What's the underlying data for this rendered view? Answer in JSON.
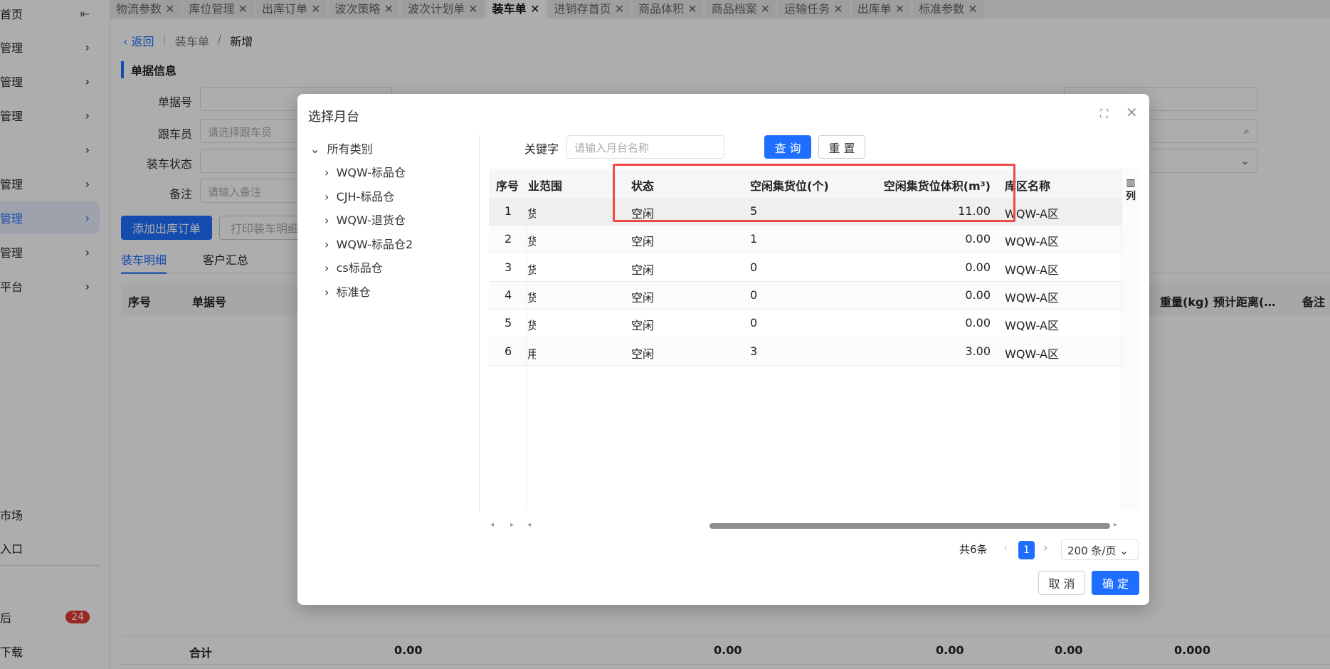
{
  "sidebar": {
    "collapse_icon": "collapse-left-icon",
    "items": [
      {
        "label": "首页"
      },
      {
        "label": "管理"
      },
      {
        "label": "管理"
      },
      {
        "label": "管理"
      },
      {
        "label": ""
      },
      {
        "label": "管理"
      },
      {
        "label": "管理",
        "active": true
      },
      {
        "label": "管理"
      },
      {
        "label": "平台"
      }
    ],
    "bottom_items": [
      {
        "label": "市场"
      },
      {
        "label": "入口"
      },
      {
        "label": "后",
        "badge": "24"
      },
      {
        "label": "下载"
      }
    ]
  },
  "tabs": [
    {
      "label": "物流参数"
    },
    {
      "label": "库位管理"
    },
    {
      "label": "出库订单"
    },
    {
      "label": "波次策略"
    },
    {
      "label": "波次计划单"
    },
    {
      "label": "装车单",
      "active": true
    },
    {
      "label": "进销存首页"
    },
    {
      "label": "商品体积"
    },
    {
      "label": "商品档案"
    },
    {
      "label": "运输任务"
    },
    {
      "label": "出库单"
    },
    {
      "label": "标准参数"
    }
  ],
  "breadcrumb": {
    "back": "返回",
    "parent": "装车单",
    "sep": "/",
    "current": "新增"
  },
  "section_title": "单据信息",
  "form": {
    "doc_no": "单据号",
    "follower": "跟车员",
    "follower_placeholder": "请选择跟车员",
    "status": "装车状态",
    "remark": "备注",
    "remark_placeholder": "请输入备注"
  },
  "actions": {
    "add_order": "添加出库订单",
    "print": "打印装车明细"
  },
  "detail_tabs": {
    "detail": "装车明细",
    "customer": "客户汇总"
  },
  "bg_table": {
    "headers": {
      "index": "序号",
      "doc_no": "单据号",
      "weight": "重量(kg)",
      "distance": "预计距离(…",
      "remark": "备注"
    },
    "totals": {
      "label": "合计",
      "v1": "0.00",
      "v2": "0.00",
      "v3": "0.00",
      "v4": "0.00",
      "v5": "0.00",
      "v6": "0"
    }
  },
  "modal": {
    "title": "选择月台",
    "tree": {
      "root": "所有类别",
      "children": [
        "WQW-标品仓",
        "CJH-标品仓",
        "WQW-退货仓",
        "WQW-标品仓2",
        "cs标品仓",
        "标准仓"
      ]
    },
    "keyword_label": "关键字",
    "keyword_placeholder": "请输入月台名称",
    "query": "查 询",
    "reset": "重 置",
    "columns": {
      "index": "序号",
      "scope": "业范围",
      "status": "状态",
      "free_slots": "空闲集货位(个)",
      "free_volume": "空闲集货位体积(m³)",
      "zone": "库区名称",
      "settings": "列"
    },
    "rows": [
      {
        "index": "1",
        "scope": "货",
        "status": "空闲",
        "free_slots": "5",
        "free_volume": "11.00",
        "zone": "WQW-A区"
      },
      {
        "index": "2",
        "scope": "货",
        "status": "空闲",
        "free_slots": "1",
        "free_volume": "0.00",
        "zone": "WQW-A区"
      },
      {
        "index": "3",
        "scope": "货",
        "status": "空闲",
        "free_slots": "0",
        "free_volume": "0.00",
        "zone": "WQW-A区"
      },
      {
        "index": "4",
        "scope": "货",
        "status": "空闲",
        "free_slots": "0",
        "free_volume": "0.00",
        "zone": "WQW-A区"
      },
      {
        "index": "5",
        "scope": "货",
        "status": "空闲",
        "free_slots": "0",
        "free_volume": "0.00",
        "zone": "WQW-A区"
      },
      {
        "index": "6",
        "scope": "用",
        "status": "空闲",
        "free_slots": "3",
        "free_volume": "3.00",
        "zone": "WQW-A区"
      }
    ],
    "pagination": {
      "total": "共6条",
      "page": "1",
      "page_size": "200 条/页"
    },
    "cancel": "取 消",
    "ok": "确 定",
    "highlight_color": "#f04848"
  }
}
